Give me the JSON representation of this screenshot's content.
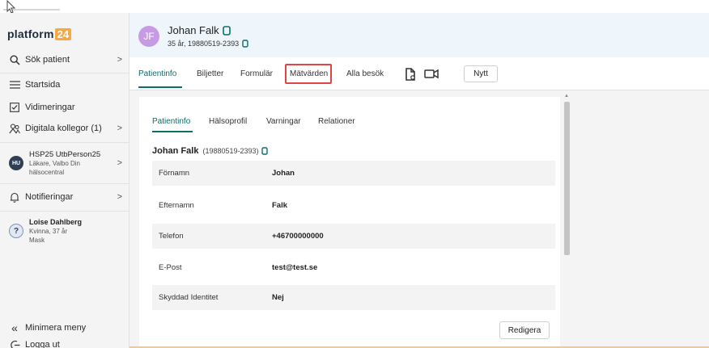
{
  "brand": {
    "name": "platform",
    "badge": "24"
  },
  "sidebar": {
    "search": "Sök patient",
    "items": [
      {
        "label": "Startsida"
      },
      {
        "label": "Vidimeringar"
      },
      {
        "label": "Digitala kollegor (1)"
      }
    ],
    "user": {
      "initials": "HU",
      "name": "HSP25 UtbPerson25",
      "role": "Läkare, Valbo Din",
      "unit": "hälsocentral"
    },
    "notifications": "Notifieringar",
    "queue_patient": {
      "name": "Loise Dahlberg",
      "info": "Kvinna, 37 år",
      "tag": "Mask"
    },
    "minimize": "Minimera meny",
    "logout": "Logga ut"
  },
  "patient": {
    "initials": "JF",
    "name": "Johan Falk",
    "meta": "35 år, 19880519-2393"
  },
  "tabs": [
    "Patientinfo",
    "Biljetter",
    "Formulär",
    "Mätvärden",
    "Alla besök"
  ],
  "new_button": "Nytt",
  "subtabs": [
    "Patientinfo",
    "Hälsoprofil",
    "Varningar",
    "Relationer"
  ],
  "info": {
    "name": "Johan Falk",
    "pnr": "(19880519-2393)",
    "rows": [
      {
        "label": "Förnamn",
        "value": "Johan"
      },
      {
        "label": "Efternamn",
        "value": "Falk"
      },
      {
        "label": "Telefon",
        "value": "+46700000000"
      },
      {
        "label": "E-Post",
        "value": "test@test.se"
      },
      {
        "label": "Skyddad Identitet",
        "value": "Nej"
      }
    ]
  },
  "edit_button": "Redigera",
  "colors": {
    "accent": "#0a6e6b",
    "highlight": "#e04545",
    "avatar": "#c79be3",
    "brand_badge": "#f7a842"
  }
}
